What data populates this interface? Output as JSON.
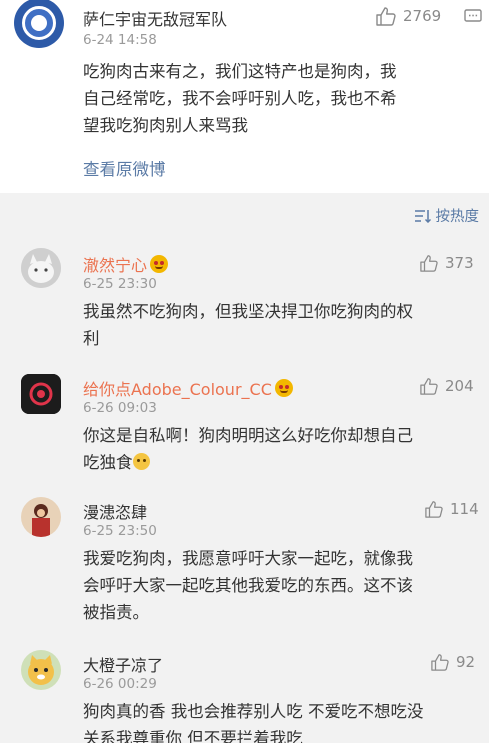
{
  "post": {
    "username": "萨仁宇宙无敌冠军队",
    "time": "6-24 14:58",
    "likes": "2769",
    "content_lines": [
      "吃狗肉古来有之，我们这特产也是狗肉，我",
      "自己经常吃，我不会呼吁别人吃，我也不希",
      "望我吃狗肉别人来骂我"
    ],
    "view_original": "查看原微博"
  },
  "sort": {
    "label": "按热度"
  },
  "comments": [
    {
      "username": "澈然宁心",
      "time": "6-25 23:30",
      "likes": "373",
      "lines": [
        "我虽然不吃狗肉，但我坚决捍卫你吃狗肉的权",
        "利"
      ]
    },
    {
      "username": "给你点Adobe_Colour_CC",
      "time": "6-26 09:03",
      "likes": "204",
      "lines": [
        "你这是自私啊！狗肉明明这么好吃你却想自己",
        "吃独食"
      ]
    },
    {
      "username": "漫漶恣肆",
      "time": "6-25 23:50",
      "likes": "114",
      "lines": [
        "我爱吃狗肉，我愿意呼吁大家一起吃，就像我",
        "会呼吁大家一起吃其他我爱吃的东西。这不该",
        "被指责。"
      ]
    },
    {
      "username": "大橙子凉了",
      "time": "6-26 00:29",
      "likes": "92",
      "lines": [
        "狗肉真的香 我也会推荐别人吃 不爱吃不想吃没",
        "关系我尊重你 但不要拦着我吃"
      ]
    }
  ],
  "colors": {
    "link": "#5b7ba6",
    "username_vip": "#eb7350",
    "text": "#333333",
    "meta": "#9a9a9a",
    "background": "#f2f2f2"
  },
  "icons": [
    "thumbs-up-icon",
    "comment-icon",
    "sort-icon",
    "vip-badge-icon",
    "emoji-icon"
  ]
}
